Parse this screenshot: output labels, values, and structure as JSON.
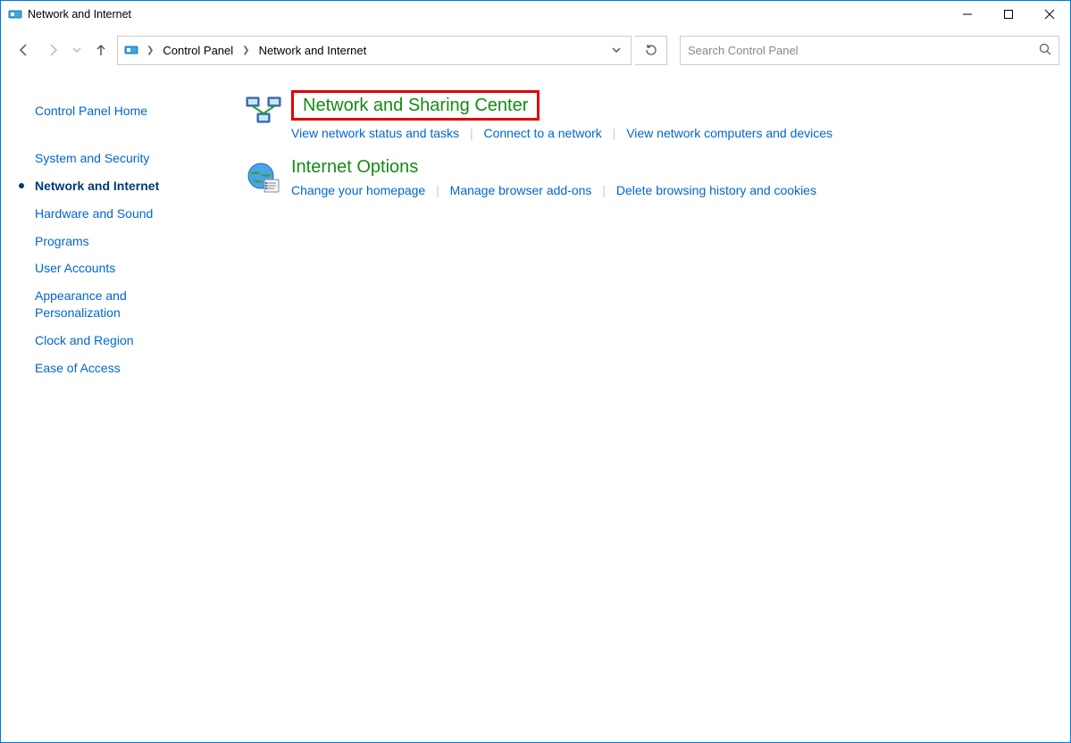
{
  "window": {
    "title": "Network and Internet"
  },
  "nav": {
    "breadcrumb": [
      "Control Panel",
      "Network and Internet"
    ]
  },
  "search": {
    "placeholder": "Search Control Panel"
  },
  "sidebar": {
    "items": [
      {
        "label": "Control Panel Home",
        "active": false
      },
      {
        "label": "System and Security",
        "active": false
      },
      {
        "label": "Network and Internet",
        "active": true
      },
      {
        "label": "Hardware and Sound",
        "active": false
      },
      {
        "label": "Programs",
        "active": false
      },
      {
        "label": "User Accounts",
        "active": false
      },
      {
        "label": "Appearance and Personalization",
        "active": false
      },
      {
        "label": "Clock and Region",
        "active": false
      },
      {
        "label": "Ease of Access",
        "active": false
      }
    ]
  },
  "main": {
    "sections": [
      {
        "title": "Network and Sharing Center",
        "highlighted": true,
        "links": [
          "View network status and tasks",
          "Connect to a network",
          "View network computers and devices"
        ]
      },
      {
        "title": "Internet Options",
        "highlighted": false,
        "links": [
          "Change your homepage",
          "Manage browser add-ons",
          "Delete browsing history and cookies"
        ]
      }
    ]
  }
}
